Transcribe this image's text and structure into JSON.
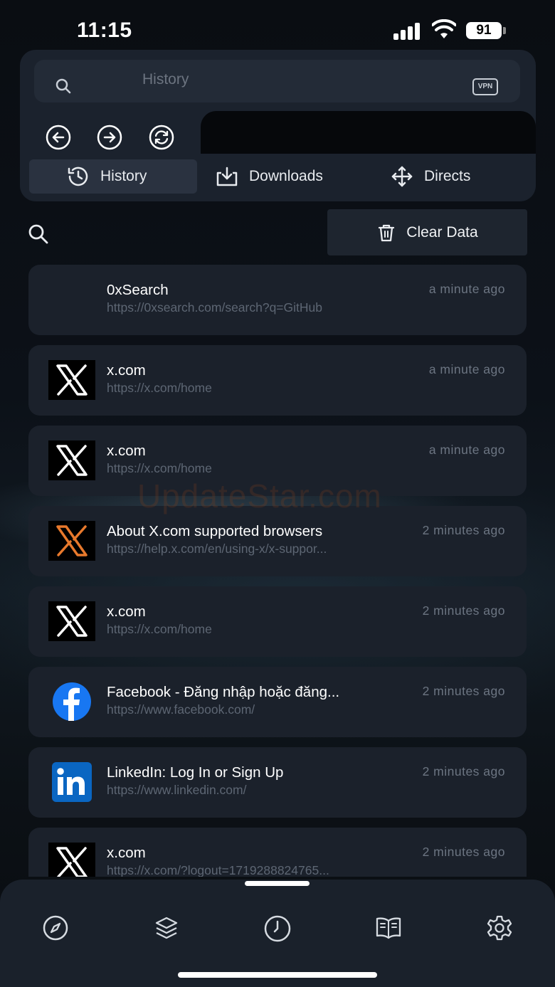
{
  "status_bar": {
    "time": "11:15",
    "battery": "91"
  },
  "address_bar": {
    "text": "History",
    "vpn_label": "VPN"
  },
  "nav": {
    "back": "back-icon",
    "forward": "forward-icon",
    "reload": "reload-icon"
  },
  "tabs": [
    {
      "label": "History",
      "icon": "clock-icon",
      "active": true
    },
    {
      "label": "Downloads",
      "icon": "download-icon",
      "active": false
    },
    {
      "label": "Directs",
      "icon": "move-icon",
      "active": false
    }
  ],
  "toolbar": {
    "clear_label": "Clear Data"
  },
  "watermark": "UpdateStar.com",
  "history": [
    {
      "title": "0xSearch",
      "url": "https://0xsearch.com/search?q=GitHub",
      "time": "a minute ago",
      "icon": "none"
    },
    {
      "title": "x.com",
      "url": "https://x.com/home",
      "time": "a minute ago",
      "icon": "x-logo-icon"
    },
    {
      "title": "x.com",
      "url": "https://x.com/home",
      "time": "a minute ago",
      "icon": "x-logo-icon"
    },
    {
      "title": "About X.com supported browsers",
      "url": "https://help.x.com/en/using-x/x-suppor...",
      "time": "2 minutes ago",
      "icon": "x-logo-orange-icon"
    },
    {
      "title": "x.com",
      "url": "https://x.com/home",
      "time": "2 minutes ago",
      "icon": "x-logo-icon"
    },
    {
      "title": "Facebook - Đăng nhập hoặc đăng...",
      "url": "https://www.facebook.com/",
      "time": "2 minutes ago",
      "icon": "facebook-icon"
    },
    {
      "title": "LinkedIn: Log In or Sign Up",
      "url": "https://www.linkedin.com/",
      "time": "2 minutes ago",
      "icon": "linkedin-icon"
    },
    {
      "title": "x.com",
      "url": "https://x.com/?logout=1719288824765...",
      "time": "2 minutes ago",
      "icon": "x-logo-icon"
    }
  ],
  "bottom_nav": [
    "compass-icon",
    "layers-icon",
    "clock-icon",
    "book-icon",
    "settings-icon"
  ],
  "colors": {
    "panel": "#1b222d",
    "item": "#1b212b",
    "muted": "#5d6673",
    "accent_facebook": "#1877f2",
    "accent_linkedin": "#0a66c2",
    "accent_x_orange": "#e8792c"
  }
}
